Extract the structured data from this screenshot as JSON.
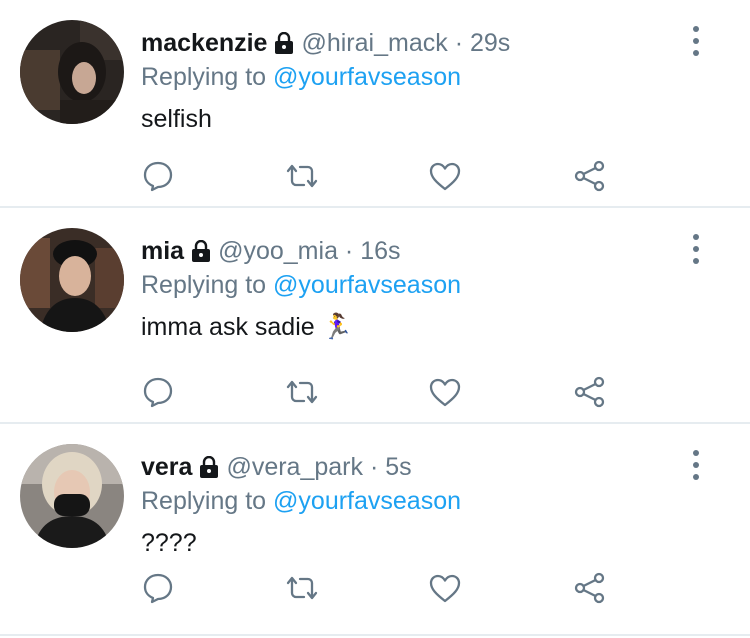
{
  "replies": [
    {
      "name": "mackenzie",
      "handle": "@hirai_mack",
      "sep": "·",
      "time": "29s",
      "replying_prefix": "Replying to",
      "replying_to": "@yourfavseason",
      "text": "selfish"
    },
    {
      "name": "mia",
      "handle": "@yoo_mia",
      "sep": "·",
      "time": "16s",
      "replying_prefix": "Replying to",
      "replying_to": "@yourfavseason",
      "text": "imma ask sadie 🏃‍♀️"
    },
    {
      "name": "vera",
      "handle": "@vera_park",
      "sep": "·",
      "time": "5s",
      "replying_prefix": "Replying to",
      "replying_to": "@yourfavseason",
      "text": "????"
    }
  ],
  "colors": {
    "name": "#14171a",
    "secondary": "#657786",
    "mention": "#1da1f2",
    "divider": "#e6ecf0"
  },
  "icons": [
    "lock-icon",
    "more-icon",
    "reply-icon",
    "retweet-icon",
    "like-icon",
    "share-icon"
  ]
}
